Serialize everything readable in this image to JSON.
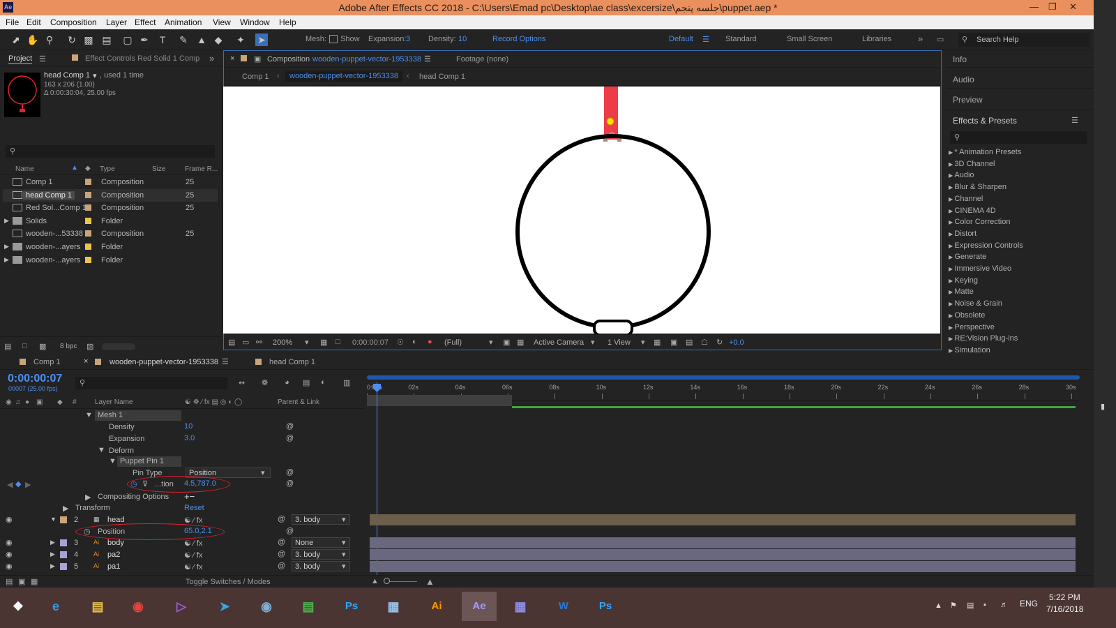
{
  "window": {
    "title": "Adobe After Effects CC 2018 - C:\\Users\\Emad pc\\Desktop\\ae class\\excersize\\جلسه پنجم\\puppet.aep *",
    "logo": "Ae"
  },
  "menu": [
    "File",
    "Edit",
    "Composition",
    "Layer",
    "Effect",
    "Animation",
    "View",
    "Window",
    "Help"
  ],
  "toolbar": {
    "mesh_label": "Mesh:",
    "show_label": "Show",
    "expansion_label": "Expansion:",
    "expansion_value": "3",
    "density_label": "Density:",
    "density_value": "10",
    "record_options": "Record Options",
    "workspaces": [
      "Default",
      "Standard",
      "Small Screen",
      "Libraries"
    ],
    "search_help": "Search Help"
  },
  "project_panel": {
    "tab_project": "Project",
    "tab_effect_controls": "Effect Controls Red Solid 1 Comp",
    "selected_name": "head Comp 1",
    "used": ", used 1 time",
    "dims": "163 x 206 (1.00)",
    "duration": "Δ 0:00:30:04, 25.00 fps",
    "columns": [
      "Name",
      "Type",
      "Size",
      "Frame R..."
    ],
    "items": [
      {
        "name": "Comp 1",
        "type": "Composition",
        "fr": "25",
        "color": "#c9a57a",
        "kind": "comp"
      },
      {
        "name": "head Comp 1",
        "type": "Composition",
        "fr": "25",
        "color": "#c9a57a",
        "kind": "comp",
        "selected": true
      },
      {
        "name": "Red Sol...Comp 1",
        "type": "Composition",
        "fr": "25",
        "color": "#c9a57a",
        "kind": "comp"
      },
      {
        "name": "Solids",
        "type": "Folder",
        "fr": "",
        "color": "#e8c64b",
        "kind": "folder"
      },
      {
        "name": "wooden-...53338",
        "type": "Composition",
        "fr": "25",
        "color": "#c9a57a",
        "kind": "comp"
      },
      {
        "name": "wooden-...ayers",
        "type": "Folder",
        "fr": "",
        "color": "#e8c64b",
        "kind": "folder"
      },
      {
        "name": "wooden-...ayers",
        "type": "Folder",
        "fr": "",
        "color": "#e8c64b",
        "kind": "folder"
      }
    ],
    "bpc": "8 bpc"
  },
  "viewer": {
    "tab_label": "Composition",
    "tab_comp": "wooden-puppet-vector-1953338",
    "footage": "Footage (none)",
    "breadcrumbs": [
      "Comp 1",
      "wooden-puppet-vector-1953338",
      "head Comp 1"
    ],
    "zoom": "200%",
    "timecode": "0:00:00:07",
    "resolution": "(Full)",
    "camera": "Active Camera",
    "views": "1 View",
    "exposure": "+0.0"
  },
  "right_panel": {
    "sections": [
      "Info",
      "Audio",
      "Preview",
      "Effects & Presets"
    ],
    "effects": [
      "* Animation Presets",
      "3D Channel",
      "Audio",
      "Blur & Sharpen",
      "Channel",
      "CINEMA 4D",
      "Color Correction",
      "Distort",
      "Expression Controls",
      "Generate",
      "Immersive Video",
      "Keying",
      "Matte",
      "Noise & Grain",
      "Obsolete",
      "Perspective",
      "RE:Vision Plug-ins",
      "Simulation"
    ]
  },
  "timeline": {
    "tabs": [
      "Comp 1",
      "wooden-puppet-vector-1953338",
      "head Comp 1"
    ],
    "timecode": "0:00:00:07",
    "frames": "00007 (25.00 fps)",
    "col_layer": "Layer Name",
    "col_parent": "Parent & Link",
    "ruler": [
      "0:00s",
      "02s",
      "04s",
      "06s",
      "08s",
      "10s",
      "12s",
      "14s",
      "16s",
      "18s",
      "20s",
      "22s",
      "24s",
      "26s",
      "28s",
      "30s"
    ],
    "mesh": "Mesh 1",
    "density_label": "Density",
    "density_value": "10",
    "expansion_label": "Expansion",
    "expansion_value": "3.0",
    "deform": "Deform",
    "pin": "Puppet Pin 1",
    "pin_type_label": "Pin Type",
    "pin_type_value": "Position",
    "pos_label": "...tion",
    "pos_value": "4.5,787.0",
    "compositing": "Compositing Options",
    "transform": "Transform",
    "reset": "Reset",
    "layers": [
      {
        "num": "2",
        "name": "head",
        "parent": "3. body",
        "color": "#c9a57a"
      },
      {
        "num": "3",
        "name": "body",
        "parent": "None",
        "color": "#a9a0d8"
      },
      {
        "num": "4",
        "name": "pa2",
        "parent": "3. body",
        "color": "#a9a0d8"
      },
      {
        "num": "5",
        "name": "pa1",
        "parent": "3. body",
        "color": "#a9a0d8"
      }
    ],
    "head_position_label": "Position",
    "head_position_value": "65.0,2.1",
    "toggle": "Toggle Switches / Modes"
  },
  "taskbar": {
    "lang": "ENG",
    "time": "5:22 PM",
    "date": "7/16/2018"
  }
}
